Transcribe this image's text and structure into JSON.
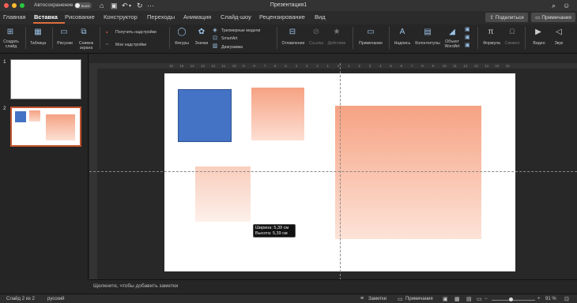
{
  "window": {
    "title": "Презентация1",
    "autosave_label": "Автосохранение",
    "autosave_state": "выкл.",
    "traffic_lights": [
      "#ff5f57",
      "#febc2e",
      "#28c840"
    ]
  },
  "tabs": [
    "Главная",
    "Вставка",
    "Рисование",
    "Конструктор",
    "Переходы",
    "Анимация",
    "Слайд-шоу",
    "Рецензирование",
    "Вид"
  ],
  "active_tab": "Вставка",
  "share_label": "Поделиться",
  "comments_label": "Примечания",
  "ribbon": {
    "new_slide": "Создать слайд",
    "table": "Таблица",
    "pictures": "Рисунки",
    "screenshot": "Снимок экрана",
    "get_addins": "Получить надстройки",
    "my_addins": "Мои надстройки",
    "shapes": "Фигуры",
    "icons": "Значки",
    "models3d": "Трехмерные модели",
    "smartart": "SmartArt",
    "chart": "Диаграмма",
    "toc": "Оглавление",
    "link": "Ссылка",
    "action": "Действие",
    "comment": "Примечание",
    "textbox": "Надпись",
    "header_footer": "Колонтитулы",
    "wordart": "Объект WordArt",
    "equation": "Формула",
    "symbol": "Символ",
    "video": "Видео",
    "audio": "Звук"
  },
  "slides": [
    "1",
    "2"
  ],
  "ruler_ticks": [
    "16",
    "15",
    "14",
    "13",
    "12",
    "11",
    "10",
    "9",
    "8",
    "7",
    "6",
    "5",
    "4",
    "3",
    "2",
    "1",
    "0",
    "1",
    "2",
    "3",
    "4",
    "5",
    "6",
    "7",
    "8",
    "9",
    "10",
    "11",
    "12",
    "13",
    "14",
    "15",
    "16"
  ],
  "tooltip": {
    "width": "Ширина: 5,39 см",
    "height": "Высота: 5,39 см"
  },
  "notes_placeholder": "Щелкните, чтобы добавить заметки",
  "status": {
    "slide_info": "Слайд 2 из 2",
    "language": "русский",
    "notes": "Заметки",
    "comments": "Примечания",
    "zoom": "91 %"
  },
  "colors": {
    "blue_square": "#4472c4",
    "salmon_top": "#f4a283",
    "accent": "#e06c3c"
  }
}
